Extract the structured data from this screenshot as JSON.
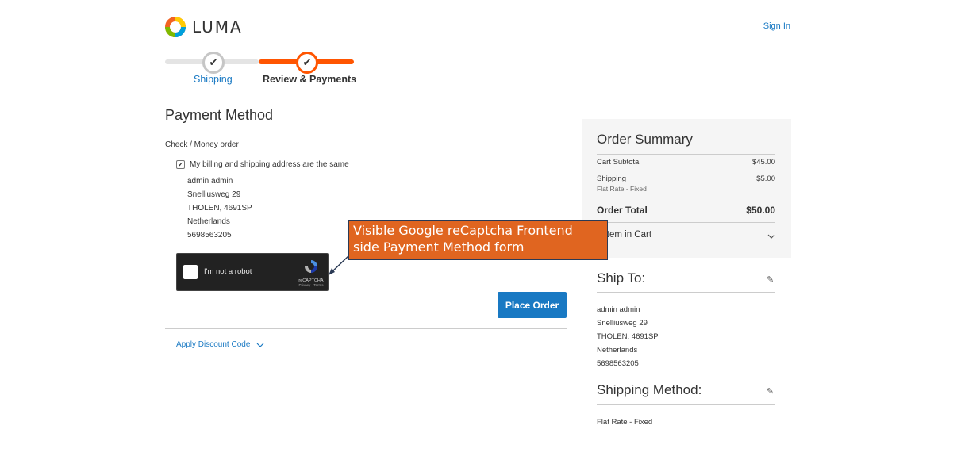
{
  "header": {
    "logo_text": "LUMA",
    "sign_in": "Sign In"
  },
  "progress": {
    "steps": [
      {
        "label": "Shipping",
        "state": "done"
      },
      {
        "label": "Review & Payments",
        "state": "active"
      }
    ],
    "check_glyph": "✔"
  },
  "payment": {
    "title": "Payment Method",
    "method_name": "Check / Money order",
    "billing_same_label": "My billing and shipping address are the same",
    "billing_same_checked": true,
    "address": {
      "name": "admin admin",
      "street": "Snelliusweg 29",
      "city": "THOLEN, 4691SP",
      "country": "Netherlands",
      "phone": "5698563205"
    },
    "recaptcha": {
      "label": "I'm not a robot",
      "brand": "reCAPTCHA",
      "terms": "Privacy - Terms"
    },
    "place_order": "Place Order",
    "discount_label": "Apply Discount Code"
  },
  "annotation": {
    "line1": "Visible Google reCaptcha Frontend",
    "line2": "side Payment Method form"
  },
  "summary": {
    "title": "Order Summary",
    "cart_subtotal_label": "Cart Subtotal",
    "cart_subtotal_value": "$45.00",
    "shipping_label": "Shipping",
    "shipping_value": "$5.00",
    "shipping_method_sub": "Flat Rate - Fixed",
    "order_total_label": "Order Total",
    "order_total_value": "$50.00",
    "items_in_cart": "1 Item in Cart"
  },
  "ship_to": {
    "title": "Ship To:",
    "name": "admin admin",
    "street": "Snelliusweg 29",
    "city": "THOLEN, 4691SP",
    "country": "Netherlands",
    "phone": "5698563205"
  },
  "shipping_method": {
    "title": "Shipping Method:",
    "value": "Flat Rate - Fixed"
  },
  "colors": {
    "accent_orange": "#ff5501",
    "link_blue": "#1979c3",
    "annotation_bg": "#e06520"
  }
}
